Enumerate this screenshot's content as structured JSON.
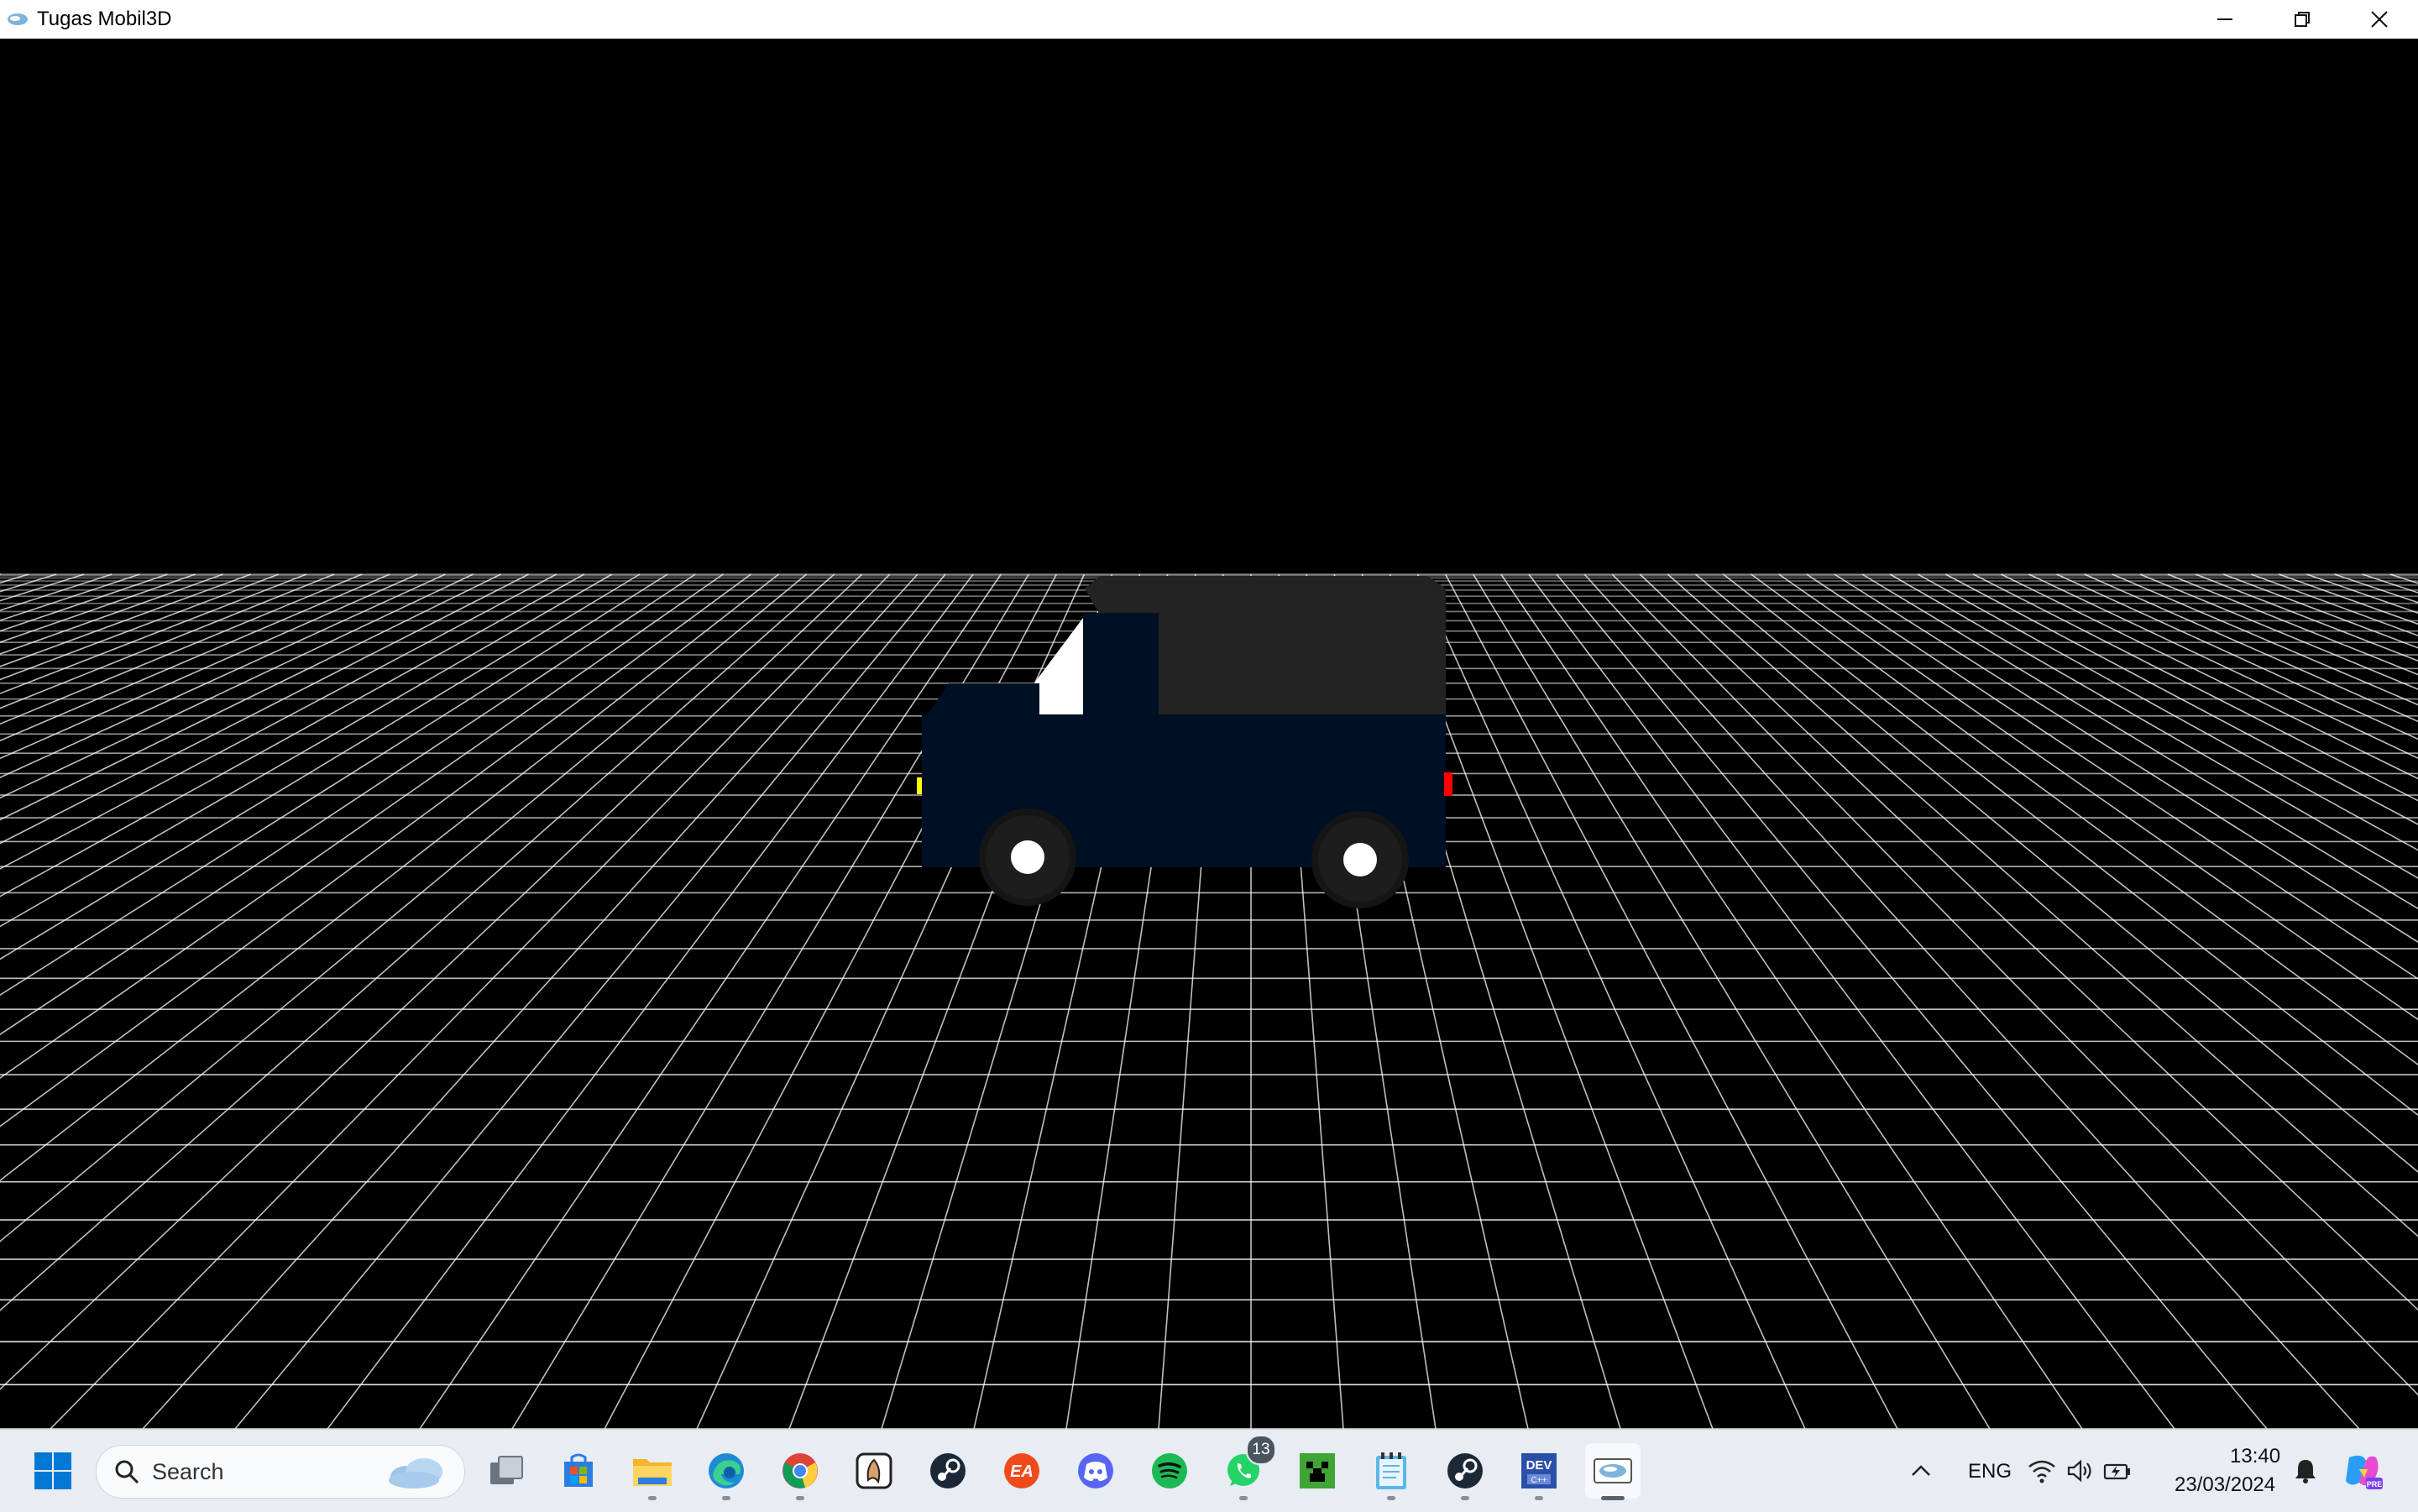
{
  "window": {
    "title": "Tugas Mobil3D",
    "controls": [
      "minimize-icon",
      "restore-icon",
      "close-icon"
    ]
  },
  "scene": {
    "background": "#000000",
    "grid_color": "#ffffff",
    "car": {
      "body_color": "#001024",
      "roof_color": "#232323",
      "window_color": "#ffffff",
      "tire_color": "#151515",
      "hub_color": "#ffffff",
      "headlight_color": "#ffff00",
      "taillight_color": "#ff0000"
    }
  },
  "taskbar": {
    "search": {
      "placeholder": "Search"
    },
    "apps": [
      {
        "name": "start-icon"
      },
      {
        "name": "task-view-icon"
      },
      {
        "name": "microsoft-store-icon"
      },
      {
        "name": "file-explorer-icon"
      },
      {
        "name": "edge-icon"
      },
      {
        "name": "chrome-icon"
      },
      {
        "name": "inkscape-icon"
      },
      {
        "name": "steam-icon"
      },
      {
        "name": "ea-icon"
      },
      {
        "name": "discord-icon"
      },
      {
        "name": "spotify-icon"
      },
      {
        "name": "whatsapp-icon",
        "badge": "13"
      },
      {
        "name": "minecraft-icon"
      },
      {
        "name": "notepad-icon"
      },
      {
        "name": "steam-icon"
      },
      {
        "name": "dev-cpp-icon"
      },
      {
        "name": "opengl-app-icon"
      }
    ],
    "tray": {
      "language": "ENG",
      "time": "13:40",
      "date": "23/03/2024"
    },
    "colors": {
      "windows_blue": "#0078d4",
      "discord": "#5865f2",
      "spotify": "#1db954",
      "whatsapp": "#25d366",
      "ea": "#f04a1c",
      "steam": "#1b2838"
    }
  }
}
